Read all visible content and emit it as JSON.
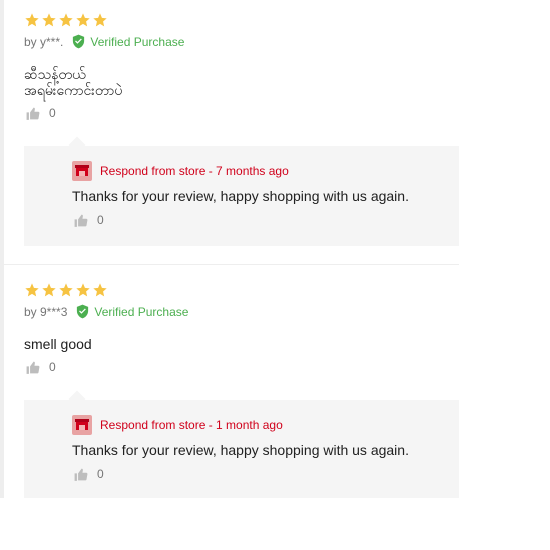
{
  "reviews": [
    {
      "rating": 5,
      "author": "by y***.",
      "verified_label": "Verified Purchase",
      "content": "ဆီသန့်တယ်\nအရမ်းကောင်းတာပဲ",
      "likes": "0",
      "reply": {
        "header": "Respond from store - 7 months ago",
        "text": "Thanks for your review, happy shopping with us again.",
        "likes": "0"
      }
    },
    {
      "rating": 5,
      "author": "by 9***3",
      "verified_label": "Verified Purchase",
      "content": "smell good",
      "likes": "0",
      "reply": {
        "header": "Respond from store - 1 month ago",
        "text": "Thanks for your review, happy shopping with us again.",
        "likes": "0"
      }
    }
  ],
  "colors": {
    "star": "#f6c342",
    "verified": "#4caf50",
    "store_accent": "#d0011b",
    "reply_bg": "#f5f5f5"
  },
  "icons": [
    "star-icon",
    "verified-check-icon",
    "thumbs-up-icon",
    "store-icon"
  ]
}
